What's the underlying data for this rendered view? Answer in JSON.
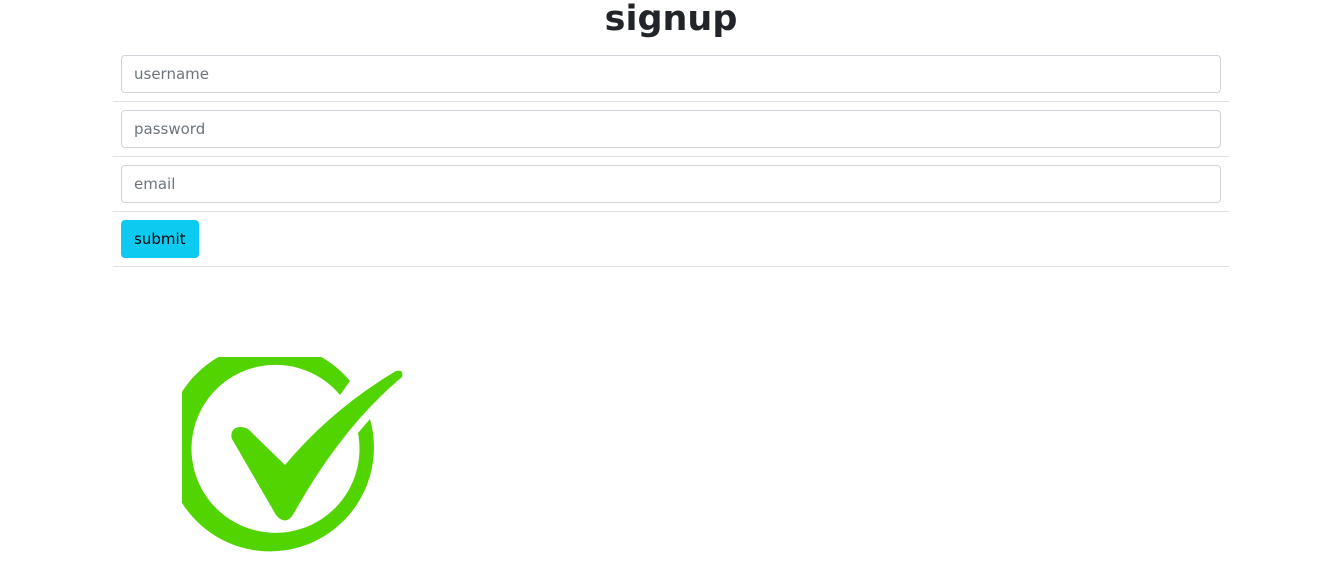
{
  "page": {
    "title": "signup"
  },
  "form": {
    "username_placeholder": "username",
    "password_placeholder": "password",
    "email_placeholder": "email",
    "submit_label": "submit"
  },
  "image": {
    "icon": "success-checkmark-icon",
    "color": "#52d400"
  }
}
